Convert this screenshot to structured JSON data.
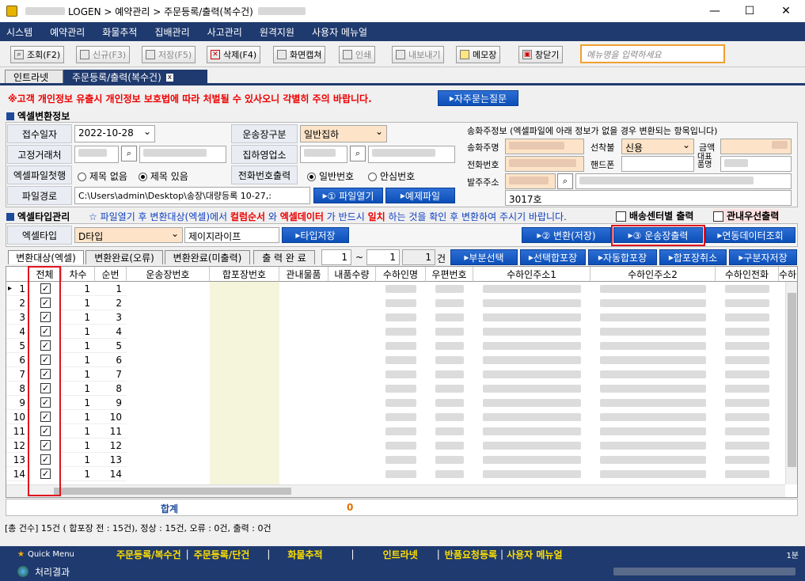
{
  "window": {
    "title": "LOGEN > 예약관리 > 주문등록/출력(복수건)",
    "minimize": "—",
    "maximize": "☐",
    "close": "✕"
  },
  "menu": [
    "시스템",
    "예약관리",
    "화물추적",
    "집배관리",
    "사고관리",
    "원격지원",
    "사용자 메뉴얼"
  ],
  "toolbar": {
    "search": "조회(F2)",
    "new": "신규(F3)",
    "save": "저장(F5)",
    "delete": "삭제(F4)",
    "capture": "화면캡쳐",
    "print": "인쇄",
    "export": "내보내기",
    "memo": "메모장",
    "close": "창닫기",
    "menu_placeholder": "메뉴명을 입력하세요"
  },
  "tabs": {
    "intranet": "인트라넷",
    "order": "주문등록/출력(복수건)",
    "close": "x"
  },
  "notice": {
    "text": "※고객 개인정보 유출시 개인정보 보호법에 따라 처벌될 수 있사오니 각별히 주의 바랍니다.",
    "faq": "자주묻는질문"
  },
  "excel_info": {
    "title": "엑셀변환정보",
    "receipt_date_label": "접수일자",
    "receipt_date": "2022-10-28",
    "waybill_type_label": "운송장구분",
    "waybill_type": "일반집하",
    "fixed_client_label": "고정거래처",
    "pickup_office_label": "집하영업소",
    "first_row_label": "엑셀파일첫행",
    "opt_no_title": "제목 없음",
    "opt_title": "제목 있음",
    "phone_out_label": "전화번호출력",
    "opt_normal": "일반번호",
    "opt_safe": "안심번호",
    "path_label": "파일경로",
    "path": "C:\\Users\\admin\\Desktop\\송장\\대량등록 10-27,:",
    "open_btn": "① 파일열기",
    "example_btn": "예제파일"
  },
  "sender": {
    "title": "송화주정보 (엑셀파일에 아래 정보가 없을 경우 변환되는 항목입니다)",
    "name_label": "송화주명",
    "pay_label": "선착불",
    "pay_value": "신용",
    "amount_label": "금액",
    "phone_label": "전화번호",
    "mobile_label": "핸드폰",
    "item_label": "대표\n품명",
    "address_label": "발주주소",
    "address2": "3017호"
  },
  "type_mgmt": {
    "title": "엑셀타입관리",
    "notice_pre": "☆ 파일열기 후 변환대상(엑셀)에서 ",
    "notice_col": "컬럼순서",
    "notice_mid": " 와 ",
    "notice_data": "엑셀데이터",
    "notice_mid2": " 가 반드시 ",
    "notice_match": "일치",
    "notice_post": " 하는 것을 확인 후 변환하여 주시기 바랍니다.",
    "chk_center": "배송센터별 출력",
    "chk_priority": "관내우선출력",
    "excel_type_label": "엑셀타입",
    "excel_type": "D타입",
    "type_name": "제이지라이프",
    "type_save": "타입저장",
    "convert_btn": "② 변환(저장)",
    "print_btn": "③ 운송장출력",
    "link_btn": "연동데이터조회"
  },
  "subtabs": [
    "변환대상(엑셀)",
    "변환완료(오류)",
    "변환완료(미출력)",
    "출 력 완 료"
  ],
  "range": {
    "from": "1",
    "sep": "~",
    "to": "1",
    "count": "1",
    "unit": "건"
  },
  "action_btns": [
    "부분선택",
    "선택합포장",
    "자동합포장",
    "합포장취소",
    "구분자저장"
  ],
  "grid": {
    "headers": [
      "전체",
      "차수",
      "순번",
      "운송장번호",
      "합포장번호",
      "관내물품",
      "내품수량",
      "수하인명",
      "우편번호",
      "수하인주소1",
      "수하인주소2",
      "수하인전화",
      "수하인"
    ],
    "rows": [
      {
        "rowno": "1",
        "seq": "1",
        "num": "1"
      },
      {
        "rowno": "2",
        "seq": "1",
        "num": "2"
      },
      {
        "rowno": "3",
        "seq": "1",
        "num": "3"
      },
      {
        "rowno": "4",
        "seq": "1",
        "num": "4"
      },
      {
        "rowno": "5",
        "seq": "1",
        "num": "5"
      },
      {
        "rowno": "6",
        "seq": "1",
        "num": "6"
      },
      {
        "rowno": "7",
        "seq": "1",
        "num": "7"
      },
      {
        "rowno": "8",
        "seq": "1",
        "num": "8"
      },
      {
        "rowno": "9",
        "seq": "1",
        "num": "9"
      },
      {
        "rowno": "10",
        "seq": "1",
        "num": "10"
      },
      {
        "rowno": "11",
        "seq": "1",
        "num": "11"
      },
      {
        "rowno": "12",
        "seq": "1",
        "num": "12"
      },
      {
        "rowno": "13",
        "seq": "1",
        "num": "13"
      },
      {
        "rowno": "14",
        "seq": "1",
        "num": "14"
      }
    ]
  },
  "summary": {
    "label": "합계",
    "value": "0"
  },
  "status": "[총 건수] 15건 ( 합포장 전 : 15건), 정상 : 15건, 오류 : 0건, 출력 : 0건",
  "quick": {
    "label": "Quick Menu",
    "items": [
      "주문등록/복수건",
      "주문등록/단건",
      "화물추적",
      "인트라넷",
      "반품요청등록",
      "사용자 메뉴얼"
    ],
    "right": "1분"
  },
  "result": {
    "label": "처리결과"
  }
}
